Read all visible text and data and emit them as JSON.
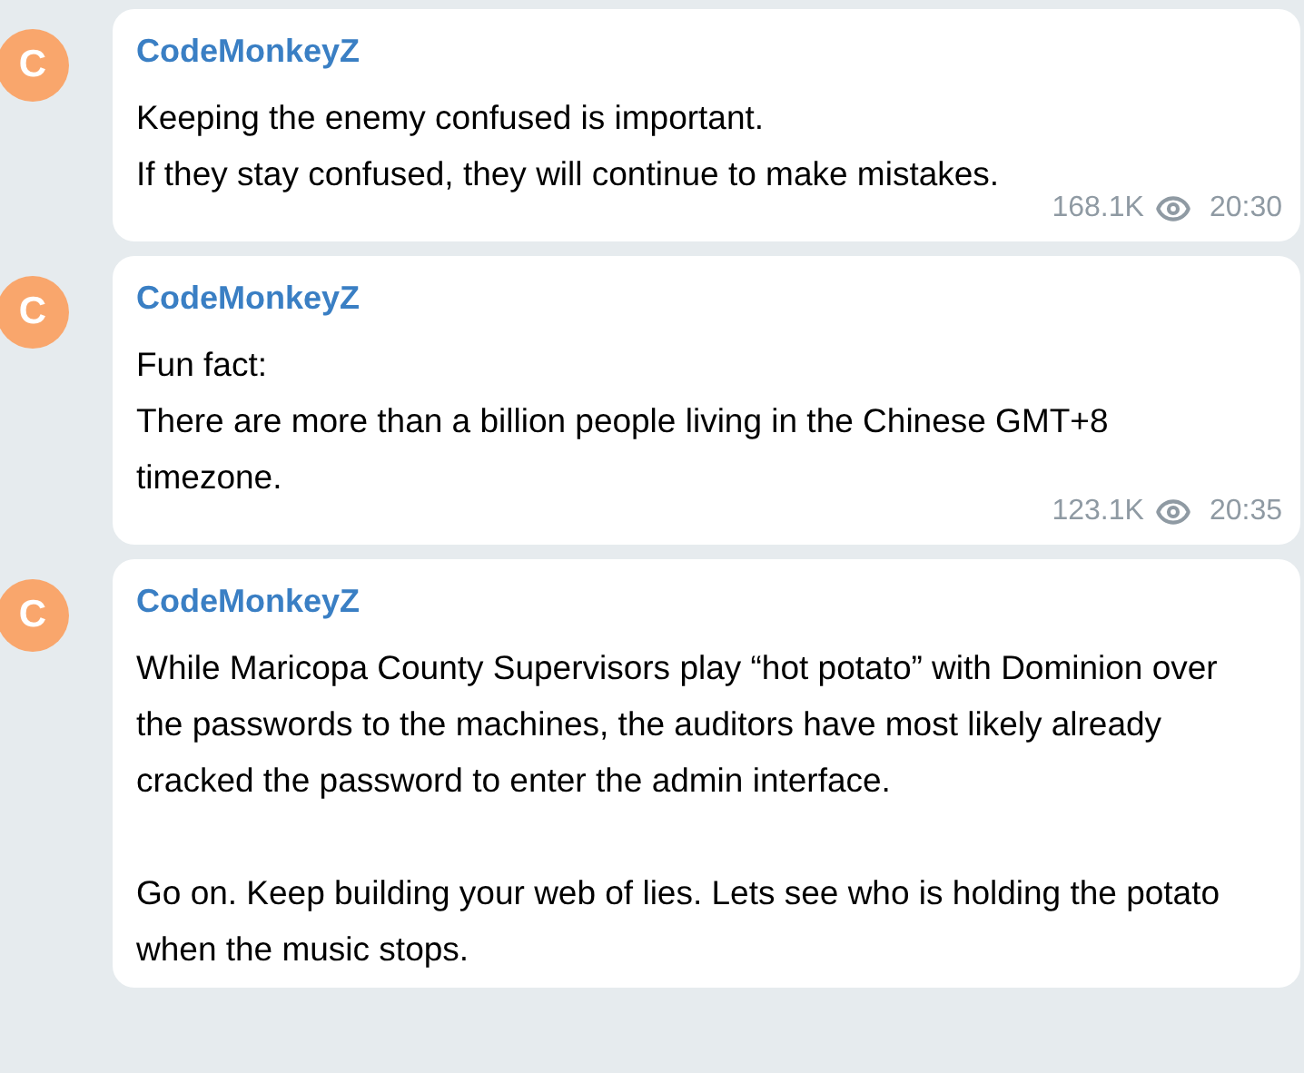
{
  "messages": [
    {
      "avatar": "C",
      "author": "CodeMonkeyZ",
      "paragraphs": [
        "Keeping the enemy confused is important.\nIf they stay confused, they will continue to make mistakes."
      ],
      "views": "168.1K",
      "time": "20:30"
    },
    {
      "avatar": "C",
      "author": "CodeMonkeyZ",
      "paragraphs": [
        "Fun fact:\nThere are more than a billion people living in the Chinese GMT+8 timezone."
      ],
      "views": "123.1K",
      "time": "20:35"
    },
    {
      "avatar": "C",
      "author": "CodeMonkeyZ",
      "paragraphs": [
        "While Maricopa County Supervisors play “hot potato” with Dominion over the passwords to the machines, the auditors have most likely already cracked the password to enter the admin interface.",
        "Go on. Keep building your web of lies. Lets see who is holding the potato when the music stops."
      ]
    }
  ]
}
